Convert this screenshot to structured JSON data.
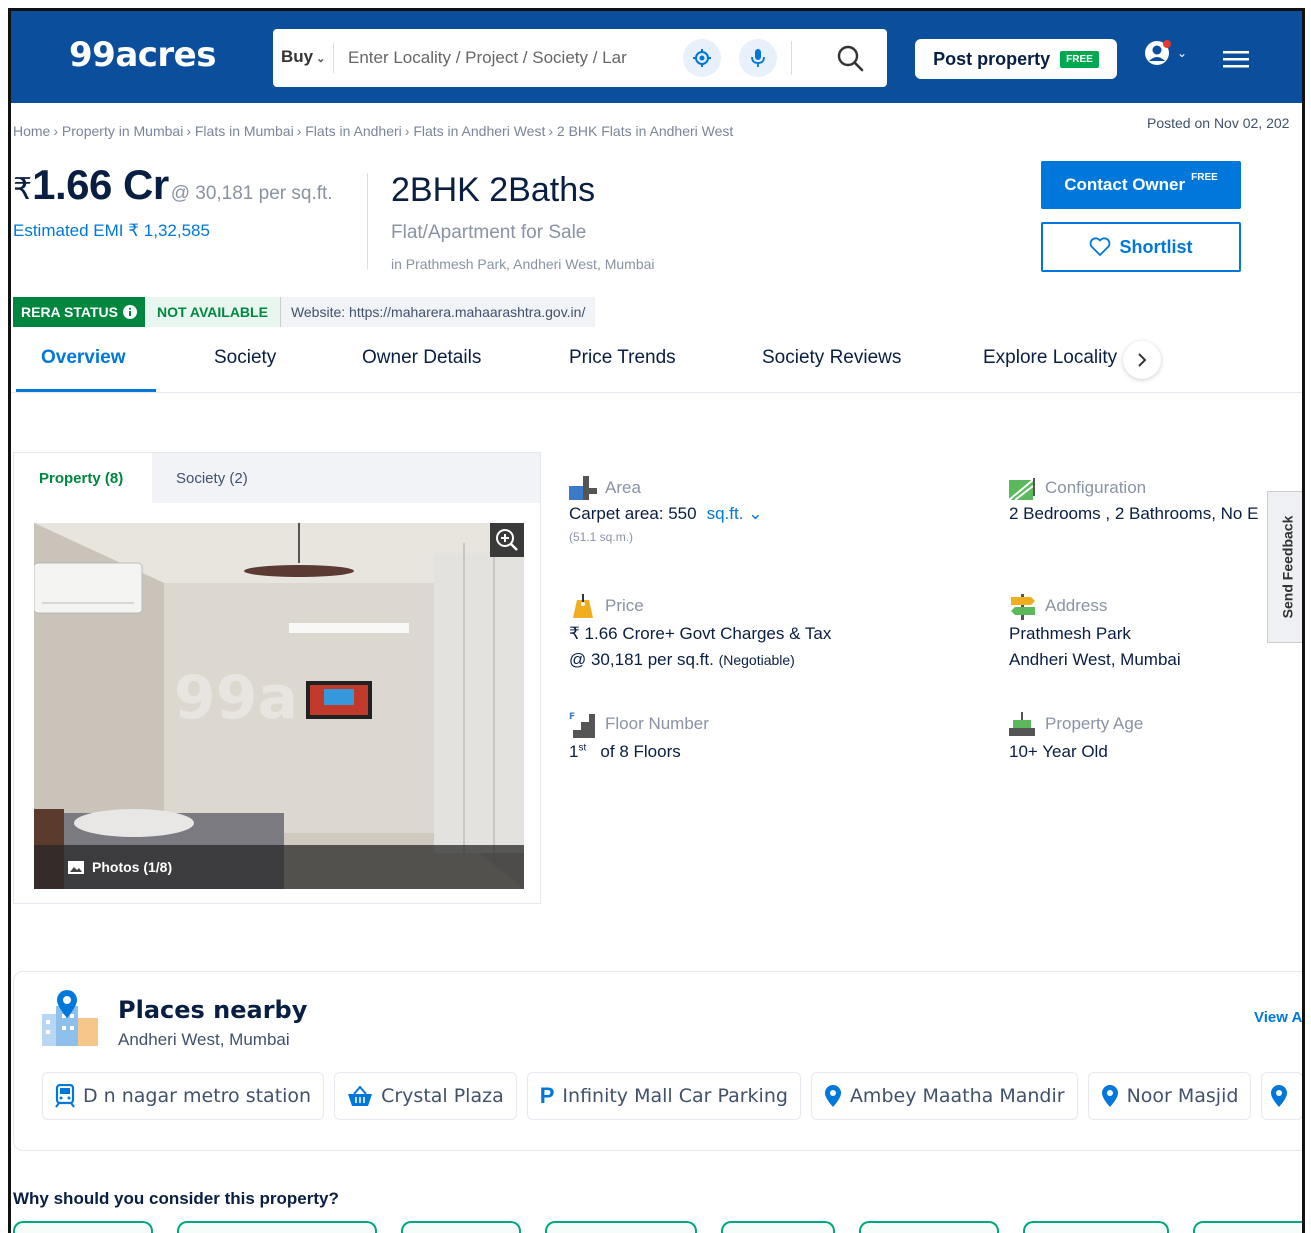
{
  "header": {
    "logo": "99acres",
    "buy_label": "Buy",
    "search_placeholder": "Enter Locality / Project / Society / Lar",
    "post_property_label": "Post property",
    "post_property_tag": "FREE"
  },
  "breadcrumb": [
    "Home",
    "Property in Mumbai",
    "Flats in Mumbai",
    "Flats in Andheri",
    "Flats in Andheri West",
    "2 BHK Flats in Andheri West"
  ],
  "posted_on": "Posted on Nov 02, 202",
  "price": {
    "rupee": "₹",
    "amount": "1.66 Cr",
    "per_sqft": "@ 30,181 per sq.ft.",
    "emi": "Estimated EMI ₹ 1,32,585"
  },
  "listing": {
    "title": "2BHK 2Baths",
    "subtitle": "Flat/Apartment for Sale",
    "location": "in Prathmesh Park, Andheri West, Mumbai"
  },
  "actions": {
    "contact_owner": "Contact Owner",
    "contact_tag": "FREE",
    "shortlist": "Shortlist"
  },
  "rera": {
    "label": "RERA STATUS",
    "status": "NOT AVAILABLE",
    "website": "Website: https://maharera.mahaarashtra.gov.in/"
  },
  "tabs": [
    "Overview",
    "Society",
    "Owner Details",
    "Price Trends",
    "Society Reviews",
    "Explore Locality"
  ],
  "gallery": {
    "tab_property": "Property (8)",
    "tab_society": "Society (2)",
    "photos_label": "Photos (1/8)"
  },
  "details": {
    "area": {
      "label": "Area",
      "value": "Carpet area: 550",
      "unit": "sq.ft.",
      "sub": "(51.1 sq.m.)"
    },
    "configuration": {
      "label": "Configuration",
      "value": "2 Bedrooms , 2 Bathrooms, No E"
    },
    "price": {
      "label": "Price",
      "line1": "₹ 1.66 Crore+ Govt Charges & Tax",
      "line2": "@ 30,181 per sq.ft.",
      "negotiable": "(Negotiable)"
    },
    "address": {
      "label": "Address",
      "line1": "Prathmesh Park",
      "line2": "Andheri West, Mumbai"
    },
    "floor": {
      "label": "Floor Number",
      "floor_num": "1",
      "floor_sup": "st",
      "of": "of 8 Floors"
    },
    "age": {
      "label": "Property Age",
      "value": "10+ Year Old"
    }
  },
  "feedback_label": "Send Feedback",
  "places": {
    "title": "Places nearby",
    "subtitle": "Andheri West, Mumbai",
    "view_all": "View Al",
    "chips": [
      {
        "icon": "metro-icon",
        "label": "D n nagar metro station"
      },
      {
        "icon": "shopping-basket-icon",
        "label": "Crystal Plaza"
      },
      {
        "icon": "parking-icon",
        "label": "Infinity Mall Car Parking"
      },
      {
        "icon": "location-pin-icon",
        "label": "Ambey Maatha Mandir"
      },
      {
        "icon": "location-pin-icon",
        "label": "Noor Masjid"
      }
    ]
  },
  "why_title": "Why should you consider this property?",
  "colors": {
    "header_bg": "#0b4f9c",
    "accent_blue": "#0078db",
    "rera_green": "#00873f",
    "free_green": "#00a84f"
  }
}
